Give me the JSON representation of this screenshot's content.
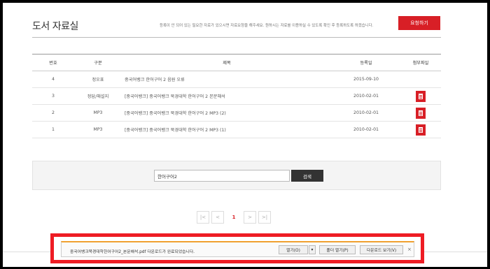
{
  "header": {
    "title": "도서 자료실",
    "notice": "등록이 안 되어 있는 필요한 자료가 있으시면 자료요청을 해주세요. 원하시는 자료를 이용하실 수 있도록 확인 후 등록하도록 하겠습니다.",
    "request_button": "요청하기"
  },
  "table": {
    "headers": [
      "번호",
      "구분",
      "제목",
      "등록일",
      "첨부파일"
    ],
    "rows": [
      {
        "num": "4",
        "category": "정오표",
        "title": "중국어뱅크 한어구어 2 음원 오류",
        "date": "2015-09-10",
        "has_file": false
      },
      {
        "num": "3",
        "category": "정답/해설지",
        "title": "[중국어뱅크] 중국어뱅크 북경대학 한어구어 2 본문해석",
        "date": "2010-02-01",
        "has_file": true
      },
      {
        "num": "2",
        "category": "MP3",
        "title": "[중국어뱅크] 중국어뱅크 북경대학 한어구어 2 MP3 (2)",
        "date": "2010-02-01",
        "has_file": true
      },
      {
        "num": "1",
        "category": "MP3",
        "title": "[중국어뱅크] 중국어뱅크 북경대학 한어구어 2 MP3 (1)",
        "date": "2010-02-01",
        "has_file": true
      }
    ]
  },
  "search": {
    "value": "한어구어2",
    "button": "검색"
  },
  "pagination": {
    "first": "|<",
    "prev": "<",
    "current": "1",
    "next": ">",
    "last": ">|"
  },
  "download_bar": {
    "message": "중국어뱅크북경대학한어구어2_본문해석.pdf 다운로드가 완료되었습니다.",
    "open": "열기(O)",
    "open_folder": "폴더 열기(P)",
    "view_downloads": "다운로드 보기(V)",
    "close": "×",
    "arrow": "▾"
  },
  "colors": {
    "accent": "#d81f26",
    "highlight_border": "#ee1c24"
  },
  "icons": {
    "attachment": "file-icon"
  }
}
